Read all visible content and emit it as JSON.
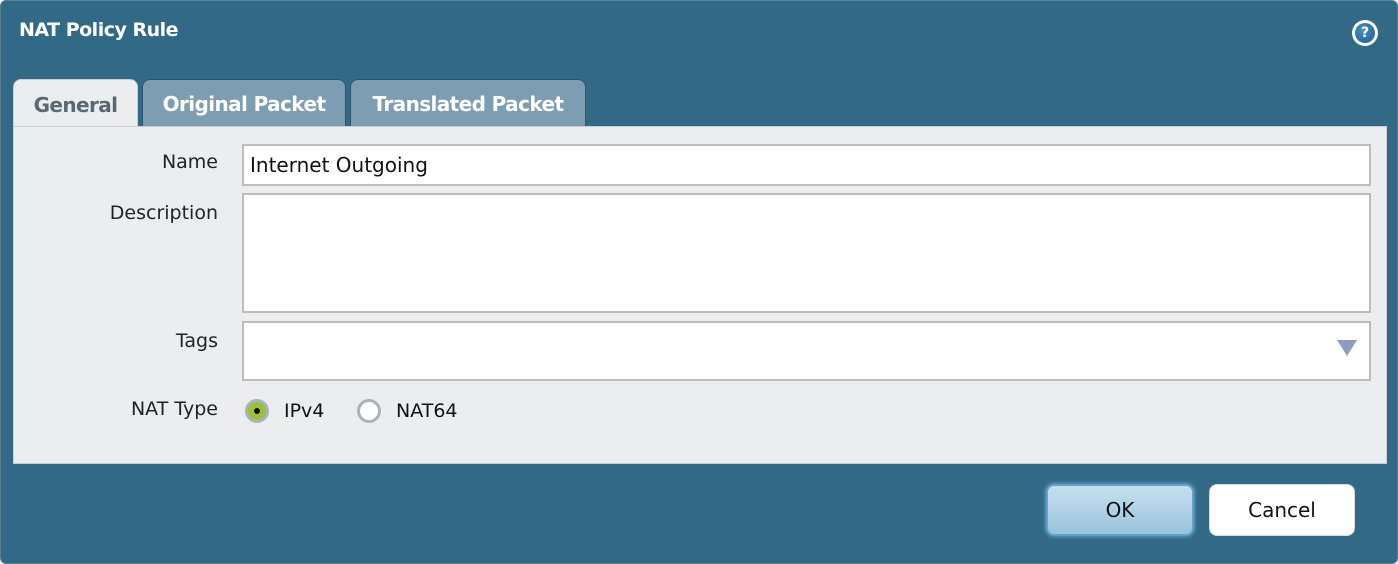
{
  "dialog": {
    "title": "NAT Policy Rule",
    "help_icon": "help-icon",
    "tabs": [
      {
        "label": "General",
        "active": true
      },
      {
        "label": "Original Packet",
        "active": false
      },
      {
        "label": "Translated Packet",
        "active": false
      }
    ],
    "form": {
      "name_label": "Name",
      "name_value": "Internet Outgoing",
      "description_label": "Description",
      "description_value": "",
      "tags_label": "Tags",
      "tags_value": "",
      "nat_type_label": "NAT Type",
      "nat_type_options": [
        {
          "label": "IPv4",
          "selected": true
        },
        {
          "label": "NAT64",
          "selected": false
        }
      ]
    },
    "buttons": {
      "ok_label": "OK",
      "cancel_label": "Cancel"
    }
  }
}
